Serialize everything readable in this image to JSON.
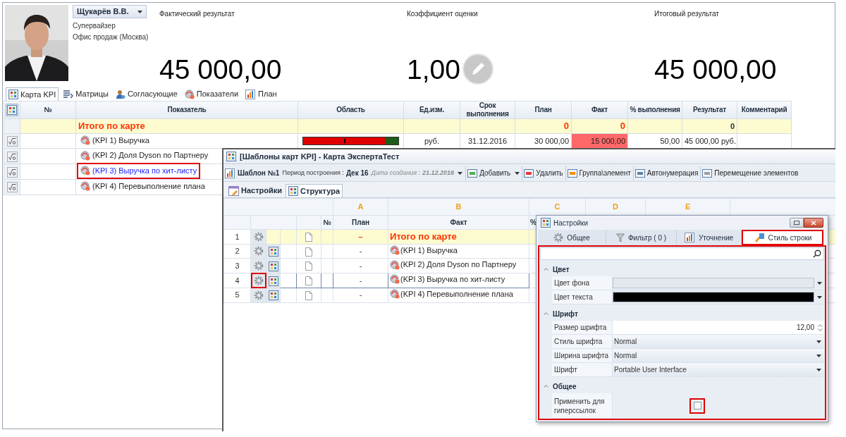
{
  "profile": {
    "name": "Щукарёв В.В.",
    "role": "Супервайзер",
    "office": "Офис продаж (Москва)"
  },
  "metrics": [
    {
      "kind": "result",
      "label": "Фактический результат",
      "value": "45 000,00"
    },
    {
      "kind": "coefficient",
      "label": "Коэффициент оценки",
      "value": "1,00"
    },
    {
      "kind": "result",
      "label": "Итоговый результат",
      "value": "45 000,00"
    }
  ],
  "tabs": [
    {
      "label": "Карта KPI",
      "selected": true
    },
    {
      "label": "Матрицы",
      "selected": false
    },
    {
      "label": "Согласующие",
      "selected": false
    },
    {
      "label": "Показатели",
      "selected": false
    },
    {
      "label": "План",
      "selected": false
    }
  ],
  "kpi_table": {
    "columns": [
      "№",
      "Показатель",
      "Область",
      "Ед.изм.",
      "Срок выполнения",
      "План",
      "Факт",
      "% выполнения",
      "Результат",
      "Комментарий"
    ],
    "total_row": {
      "label": "Итого по карте",
      "plan": "0",
      "fact": "0",
      "result": "0"
    },
    "rows": [
      {
        "label": "(KPI 1) Выручка",
        "selected": false,
        "highlighted": false,
        "area": {
          "level": 0.86,
          "marker": {
            "level": 0.43
          }
        },
        "unit": "руб.",
        "deadline": "31.12.2016",
        "plan": "30 000,00",
        "fact": "15 000,00",
        "fact_alert": true,
        "percent": "50,00",
        "result": "45 000,00 руб."
      },
      {
        "label": "(KPI 2) Доля Dyson по Партнеру",
        "selected": false,
        "highlighted": false
      },
      {
        "label": "(KPI 3) Выручка по хит-листу",
        "selected": true,
        "highlighted": true
      },
      {
        "label": "(KPI 4) Перевыполнение плана",
        "selected": false,
        "highlighted": false
      }
    ]
  },
  "template_window": {
    "title": "[Шаблоны карт KPI] - Карта ЭкспертаТест",
    "template": "Шаблон №1",
    "period_label": "Период построения :",
    "period": "Дек 16",
    "created_label": "Дата создания :",
    "created": "21.12.2016",
    "actions": [
      {
        "label": "Добавить",
        "dropdown": true
      },
      {
        "label": "Удалить",
        "dropdown": false
      },
      {
        "label": "Группа\\элемент",
        "dropdown": false
      },
      {
        "label": "Автонумерация",
        "dropdown": false
      },
      {
        "label": "Перемещение элементов",
        "dropdown": false
      }
    ],
    "tabs": [
      {
        "label": "Настройки",
        "selected": false
      },
      {
        "label": "Структура",
        "selected": true
      }
    ],
    "grid": {
      "letters": [
        "A",
        "B",
        "C",
        "D",
        "E"
      ],
      "columns": [
        "№",
        "План",
        "Факт",
        "%"
      ],
      "rows": [
        {
          "number": "1",
          "kind": "total",
          "plan": "–",
          "fact": "Итого по карте",
          "selected": false,
          "highlighted": false
        },
        {
          "number": "2",
          "kind": "kpi",
          "plan": "-",
          "fact": "(KPI 1) Выручка",
          "selected": false,
          "highlighted": false
        },
        {
          "number": "3",
          "kind": "kpi",
          "plan": "-",
          "fact": "(KPI 2) Доля Dyson по Партнеру",
          "selected": false,
          "highlighted": false
        },
        {
          "number": "4",
          "kind": "kpi",
          "plan": "-",
          "fact": "(KPI 3) Выручка по хит-листу",
          "selected": true,
          "highlighted": true
        },
        {
          "number": "5",
          "kind": "kpi",
          "plan": "-",
          "fact": "(KPI 4) Перевыполнение плана",
          "selected": false,
          "highlighted": false
        }
      ]
    }
  },
  "settings_dialog": {
    "title": "Настройки",
    "panel_highlighted": true,
    "tabs": [
      {
        "label": "Общее",
        "selected": false,
        "highlighted": false
      },
      {
        "label": "Фильтр ( 0 )",
        "selected": false,
        "highlighted": false
      },
      {
        "label": "Уточнение",
        "selected": false,
        "highlighted": false
      },
      {
        "label": "Стиль строки",
        "selected": true,
        "highlighted": true
      }
    ],
    "sections": [
      {
        "title": "Цвет",
        "expanded": true,
        "properties": [
          {
            "kind": "color",
            "label": "Цвет фона",
            "color": "#e3e8ef"
          },
          {
            "kind": "color",
            "label": "Цвет текста",
            "color": "#000000"
          }
        ]
      },
      {
        "title": "Шрифт",
        "expanded": true,
        "properties": [
          {
            "kind": "number",
            "label": "Размер шрифта",
            "value": "12,00"
          },
          {
            "kind": "select",
            "label": "Стиль шрифта",
            "value": "Normal"
          },
          {
            "kind": "select",
            "label": "Ширина шрифта",
            "value": "Normal"
          },
          {
            "kind": "select",
            "label": "Шрифт",
            "value": "Portable User Interface"
          }
        ]
      },
      {
        "title": "Общее",
        "expanded": true,
        "properties": [
          {
            "kind": "checkbox",
            "label": "Применить для гиперссылок",
            "checked": false,
            "highlighted": true
          }
        ]
      }
    ]
  }
}
